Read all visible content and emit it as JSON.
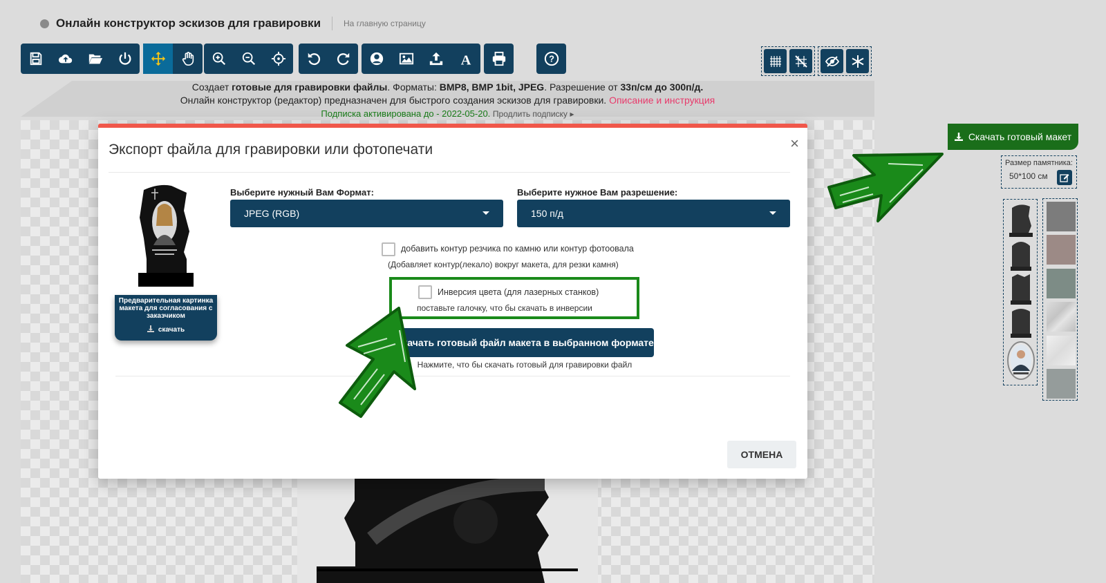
{
  "header": {
    "title": "Онлайн конструктор эскизов для гравировки",
    "home_link": "На главную страницу"
  },
  "toolbar_icons": [
    "save-icon",
    "cloud-upload-icon",
    "folder-open-icon",
    "power-icon",
    "move-icon",
    "hand-icon",
    "zoom-in-icon",
    "zoom-out-icon",
    "crosshair-icon",
    "undo-icon",
    "redo-icon",
    "user-icon",
    "image-icon",
    "upload-icon",
    "text-icon",
    "print-icon",
    "help-icon"
  ],
  "info": {
    "line1_a": "Создает ",
    "line1_b": "готовые для гравировки файлы",
    "line1_c": ". Форматы: ",
    "line1_d": "BMP8, BMP 1bit, JPEG",
    "line1_e": ". Разрешение от ",
    "line1_f": "33п/см до 300п/д.",
    "line2_a": "Онлайн конструктор (редактор) предназначен для быстрого создания эскизов для гравировки.",
    "line2_b": "Описание и инструкция",
    "line3_a": "Подписка активирована до - 2022-05-20.",
    "line3_b": "Продлить подписку",
    "line3_arrow": "▸"
  },
  "modal": {
    "title": "Экспорт файла для гравировки или фотопечати",
    "close": "×",
    "format_label": "Выберите нужный Вам Формат:",
    "format_value": "JPEG (RGB)",
    "resolution_label": "Выберите нужное Вам разрешение:",
    "resolution_value": "150 п/д",
    "contour_label": "добавить контур резчика по камню или контур фотоовала",
    "contour_hint": "(Добавляет контур(лекало) вокруг макета, для резки камня)",
    "invert_label": "Инверсия цвета (для лазерных станков)",
    "invert_hint": "поставьте галочку, что бы скачать в инверсии",
    "download_button": "Скачать готовый файл макета в выбранном формате",
    "download_hint": "Нажмите, что бы скачать готовый для гравировки файл",
    "cancel": "ОТМЕНА",
    "preview_caption": "Предварительная картинка макета для согласования с заказчиком",
    "preview_download": "скачать",
    "contour_checked": false,
    "invert_checked": false
  },
  "sidebar": {
    "download_button": "Скачать готовый макет",
    "size_label": "Размер памятника:",
    "size_value": "50*100 см"
  },
  "colors": {
    "primary": "#12405e",
    "accent_red": "#f0574a",
    "green": "#1a7d1a",
    "pink": "#e83a6b"
  }
}
